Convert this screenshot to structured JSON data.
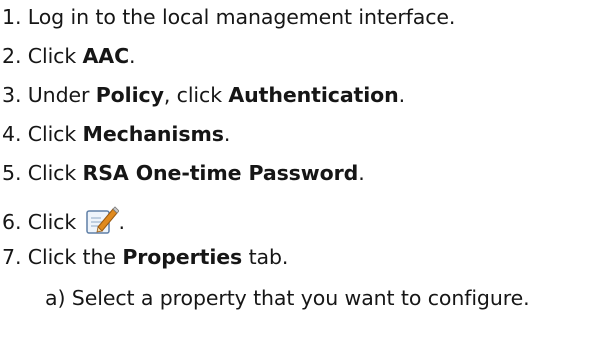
{
  "steps": [
    {
      "number": "1.",
      "text": "Log in to the local management interface."
    },
    {
      "number": "2.",
      "prefix": "Click ",
      "bold": "AAC",
      "suffix": "."
    },
    {
      "number": "3.",
      "prefix": "Under ",
      "bold": "Policy",
      "middle": ", click ",
      "bold2": "Authentication",
      "suffix": "."
    },
    {
      "number": "4.",
      "prefix": "Click ",
      "bold": "Mechanisms",
      "suffix": "."
    },
    {
      "number": "5.",
      "prefix": "Click ",
      "bold": "RSA One-time Password",
      "suffix": "."
    },
    {
      "number": "6.",
      "prefix": "Click ",
      "icon": "edit-icon",
      "suffix": "."
    },
    {
      "number": "7.",
      "prefix": "Click the ",
      "bold": "Properties",
      "suffix": " tab."
    }
  ],
  "substeps": [
    {
      "marker": "a)",
      "text": "Select a property that you want to configure."
    }
  ],
  "colors": {
    "text": "#161616",
    "icon_border": "#5f7fa6",
    "icon_fill": "#eef4fb",
    "pencil": "#e08a1e"
  }
}
